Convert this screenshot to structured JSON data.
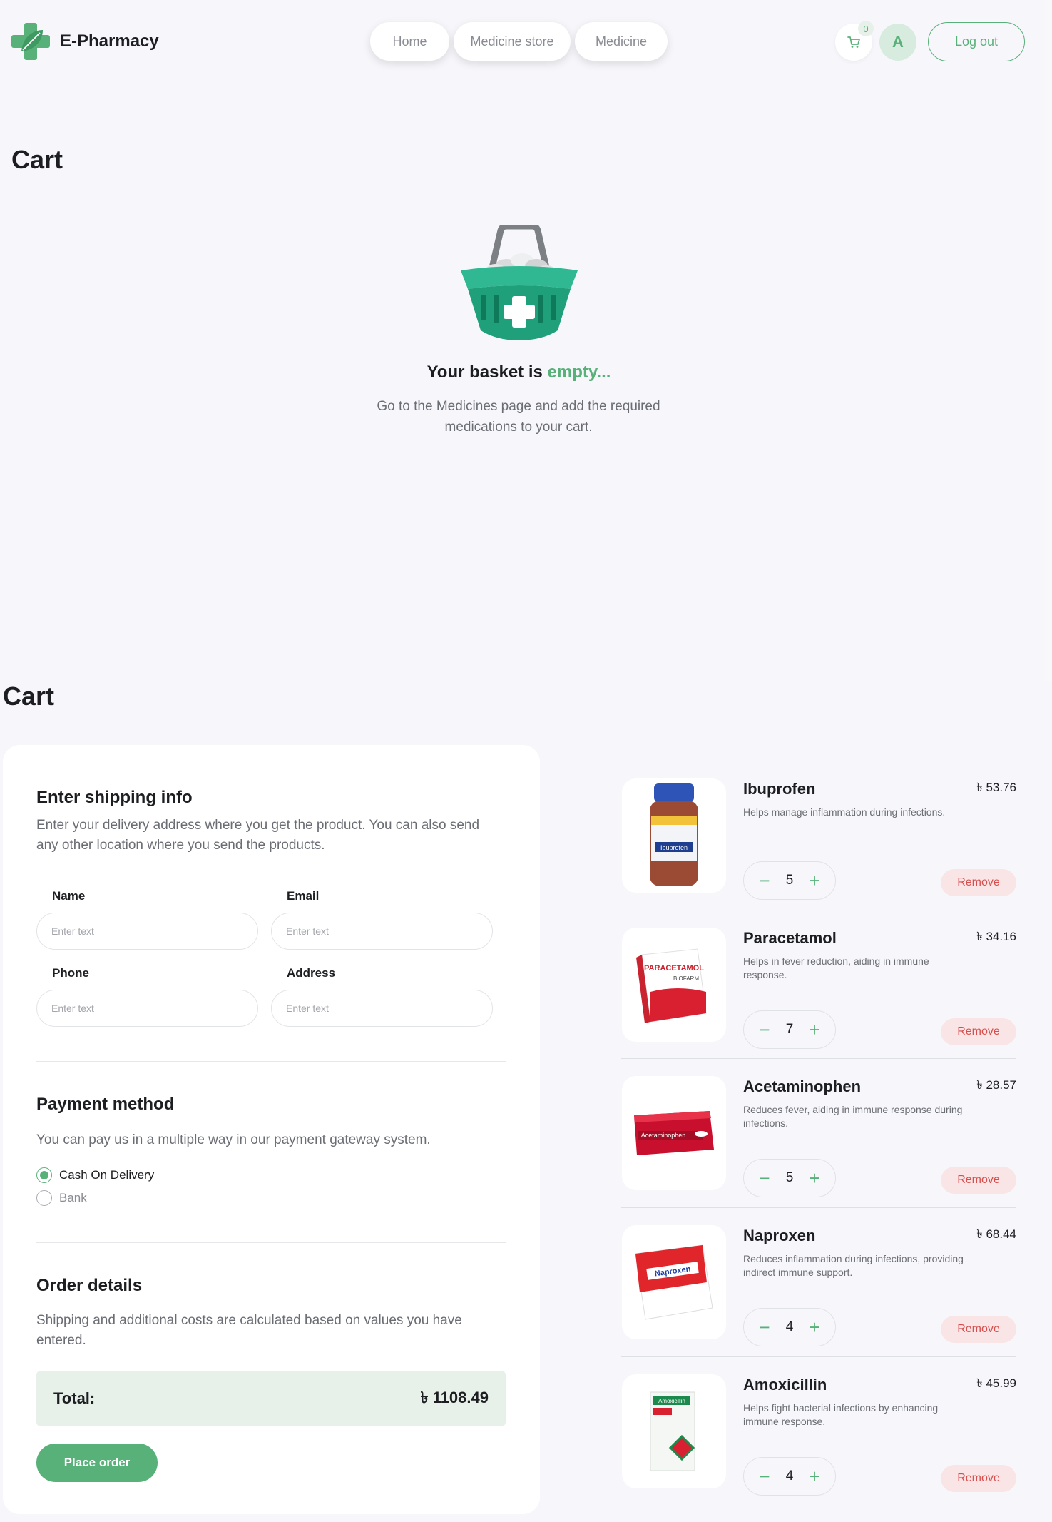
{
  "header": {
    "brand": "E-Pharmacy",
    "nav": [
      "Home",
      "Medicine store",
      "Medicine"
    ],
    "cart_count": "0",
    "avatar_initial": "A",
    "logout_label": "Log out"
  },
  "empty_cart": {
    "title": "Cart",
    "heading_prefix": "Your basket is",
    "heading_accent": "empty...",
    "description": "Go to the Medicines page and add the required medications to your cart."
  },
  "cart": {
    "title": "Cart",
    "shipping": {
      "heading": "Enter shipping info",
      "description": "Enter your delivery address where you get the product. You can also send any other location where you send the products.",
      "fields": [
        {
          "label": "Name",
          "placeholder": "Enter text"
        },
        {
          "label": "Email",
          "placeholder": "Enter text"
        },
        {
          "label": "Phone",
          "placeholder": "Enter text"
        },
        {
          "label": "Address",
          "placeholder": "Enter text"
        }
      ]
    },
    "payment": {
      "heading": "Payment method",
      "description": "You can pay us in a multiple way in our payment gateway system.",
      "options": [
        {
          "label": "Cash On Delivery",
          "checked": true
        },
        {
          "label": "Bank",
          "checked": false
        }
      ]
    },
    "order": {
      "heading": "Order details",
      "description": "Shipping and additional costs are calculated based on values you have entered.",
      "total_label": "Total:",
      "total_value": "৳ 1108.49",
      "place_order_label": "Place order"
    },
    "items": [
      {
        "name": "Ibuprofen",
        "price": "৳ 53.76",
        "description": "Helps manage inflammation during infections.",
        "qty": "5",
        "remove": "Remove"
      },
      {
        "name": "Paracetamol",
        "price": "৳ 34.16",
        "description": "Helps in fever reduction, aiding in immune response.",
        "qty": "7",
        "remove": "Remove"
      },
      {
        "name": "Acetaminophen",
        "price": "৳ 28.57",
        "description": "Reduces fever, aiding in immune response during infections.",
        "qty": "5",
        "remove": "Remove"
      },
      {
        "name": "Naproxen",
        "price": "৳ 68.44",
        "description": "Reduces inflammation during infections, providing indirect immune support.",
        "qty": "4",
        "remove": "Remove"
      },
      {
        "name": "Amoxicillin",
        "price": "৳ 45.99",
        "description": "Helps fight bacterial infections by enhancing immune response.",
        "qty": "4",
        "remove": "Remove"
      }
    ]
  },
  "colors": {
    "accent": "#59b17a",
    "accent_light": "#e7f1ea",
    "remove_bg": "#f9e5e5",
    "remove_text": "#d84e4e"
  }
}
